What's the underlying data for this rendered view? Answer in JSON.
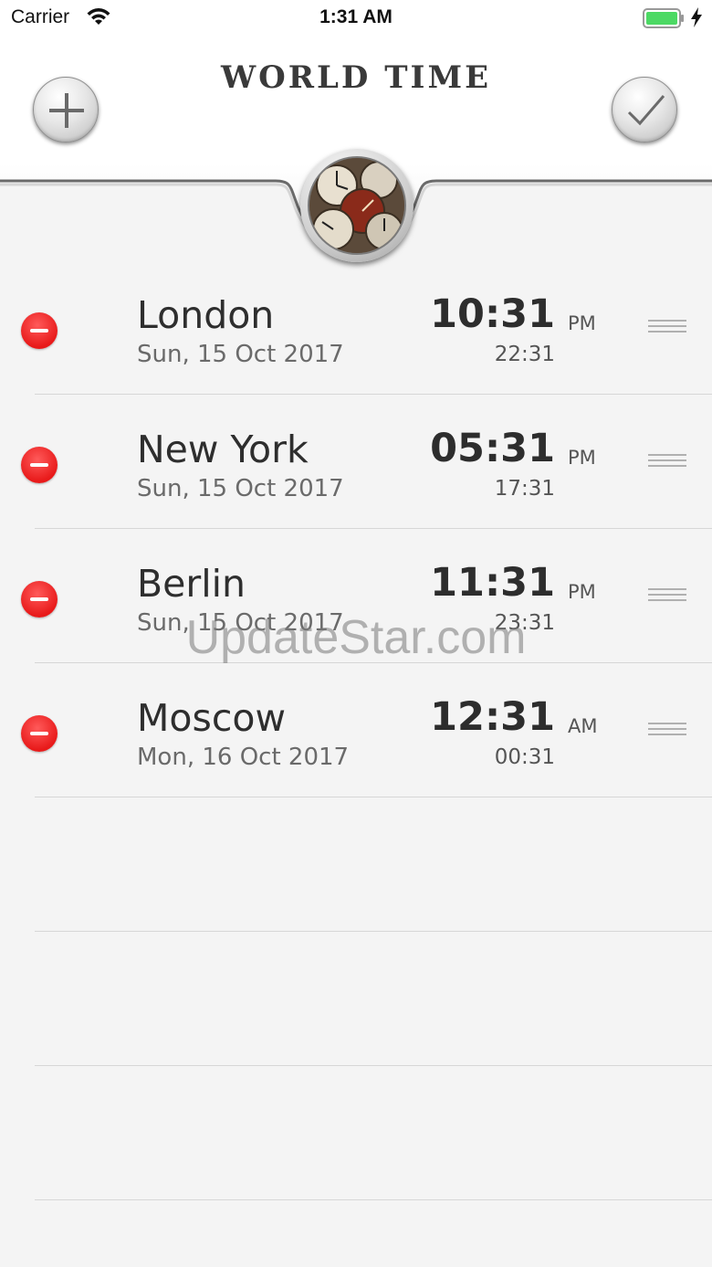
{
  "status_bar": {
    "carrier": "Carrier",
    "time": "1:31 AM"
  },
  "header": {
    "title": "WORLD TIME"
  },
  "icons": {
    "add": "plus-icon",
    "confirm": "checkmark-icon",
    "delete": "minus-icon",
    "reorder": "drag-handle-icon"
  },
  "colors": {
    "delete": "#e81a1a",
    "battery": "#4cd964"
  },
  "cities": [
    {
      "name": "London",
      "date": "Sun, 15 Oct 2017",
      "time": "10:31",
      "ampm": "PM",
      "time24": "22:31"
    },
    {
      "name": "New York",
      "date": "Sun, 15 Oct 2017",
      "time": "05:31",
      "ampm": "PM",
      "time24": "17:31"
    },
    {
      "name": "Berlin",
      "date": "Sun, 15 Oct 2017",
      "time": "11:31",
      "ampm": "PM",
      "time24": "23:31"
    },
    {
      "name": "Moscow",
      "date": "Mon, 16 Oct 2017",
      "time": "12:31",
      "ampm": "AM",
      "time24": "00:31"
    }
  ],
  "watermark": "UpdateStar.com"
}
